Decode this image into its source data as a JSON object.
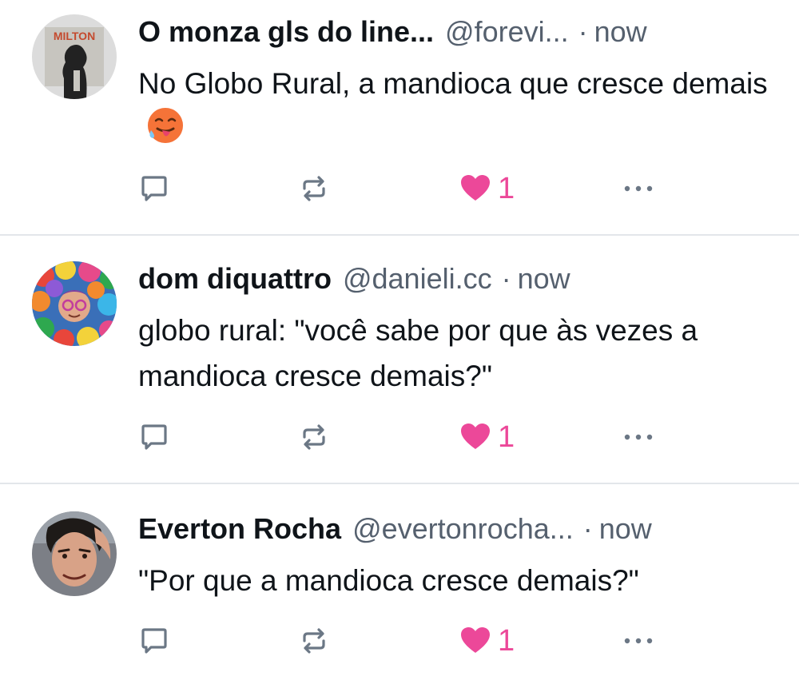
{
  "colors": {
    "like": "#ec4899",
    "icon": "#6b7785",
    "divider": "#e3e6ea",
    "secondary_text": "#55606e"
  },
  "posts": [
    {
      "author_name": "O monza gls do line...",
      "handle": "@forevi...",
      "separator": "·",
      "time": "now",
      "text": "No Globo Rural, a mandioca que cresce demais",
      "emoji": "hot-face-emoji",
      "like_count": "1",
      "liked": true,
      "avatar_text": "MILTON"
    },
    {
      "author_name": "dom diquattro",
      "handle": "@danieli.cc",
      "separator": "·",
      "time": "now",
      "text": "globo rural: \"você sabe por que às vezes a mandioca cresce demais?\"",
      "like_count": "1",
      "liked": true
    },
    {
      "author_name": "Everton Rocha",
      "handle": "@evertonrocha...",
      "separator": "·",
      "time": "now",
      "text": "\"Por que a mandioca cresce demais?\"",
      "like_count": "1",
      "liked": true
    }
  ]
}
